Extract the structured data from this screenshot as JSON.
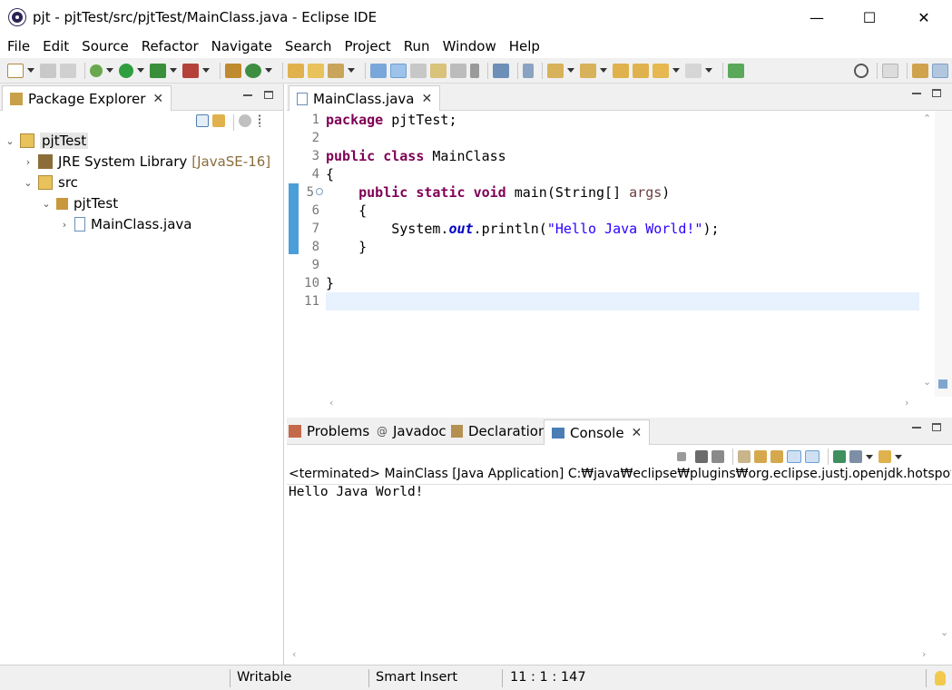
{
  "window": {
    "title": "pjt - pjtTest/src/pjtTest/MainClass.java - Eclipse IDE",
    "minimize": "—",
    "maximize": "☐",
    "close": "✕"
  },
  "menu": [
    "File",
    "Edit",
    "Source",
    "Refactor",
    "Navigate",
    "Search",
    "Project",
    "Run",
    "Window",
    "Help"
  ],
  "package_explorer": {
    "tab_label": "Package Explorer",
    "close": "✕",
    "tree": {
      "project": "pjtTest",
      "jre": "JRE System Library",
      "jre_version": "[JavaSE-16]",
      "src": "src",
      "package": "pjtTest",
      "file": "MainClass.java"
    }
  },
  "editor": {
    "tab_label": "MainClass.java",
    "close": "✕",
    "line_numbers": [
      "1",
      "2",
      "3",
      "4",
      "5",
      "6",
      "7",
      "8",
      "9",
      "10",
      "11"
    ]
  },
  "bottom_tabs": {
    "problems": "Problems",
    "javadoc": "Javadoc",
    "declaration": "Declaration",
    "console": "Console",
    "close": "✕"
  },
  "console": {
    "status": "<terminated> MainClass [Java Application] C:₩java₩eclipse₩plugins₩org.eclipse.justj.openjdk.hotspot.jre.fu",
    "output": "Hello Java World!"
  },
  "statusbar": {
    "writable": "Writable",
    "insert_mode": "Smart Insert",
    "position": "11 : 1 : 147"
  },
  "colors": {
    "keyword": "#7f0055",
    "string": "#2a00ff",
    "field": "#0000c0",
    "current_line": "#e8f2fe",
    "change_bar": "#4a9fd8"
  }
}
